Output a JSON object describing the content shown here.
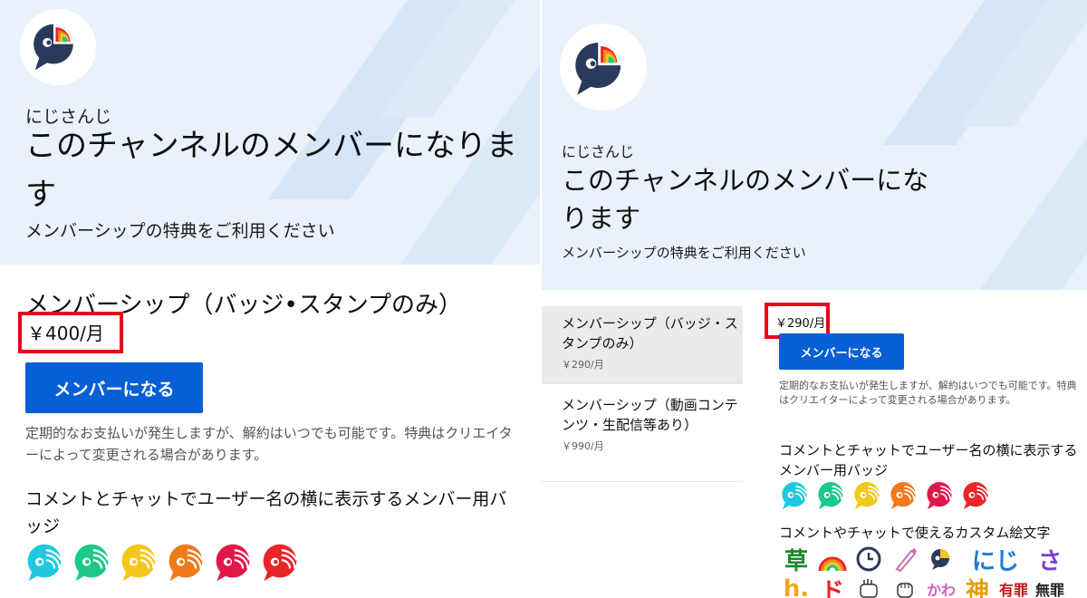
{
  "left": {
    "channel_name": "にじさんじ",
    "title": "このチャンネルのメンバーになります",
    "subtitle": "メンバーシップの特典をご利用ください",
    "tier_name": "メンバーシップ（バッジ•スタンプのみ）",
    "price": "￥400/月",
    "join_button": "メンバーになる",
    "disclaimer": "定期的なお支払いが発生しますが、解約はいつでも可能です。特典はクリエイターによって変更される場合があります。",
    "perk_title": "コメントとチャットでユーザー名の横に表示するメンバー用バッジ"
  },
  "right": {
    "channel_name": "にじさんじ",
    "title": "このチャンネルのメンバーになります",
    "subtitle": "メンバーシップの特典をご利用ください",
    "tiers": [
      {
        "name": "メンバーシップ（バッジ・スタンプのみ）",
        "price": "￥290/月"
      },
      {
        "name": "メンバーシップ（動画コンテンツ・生配信等あり）",
        "price": "￥990/月"
      }
    ],
    "price": "￥290/月",
    "join_button": "メンバーになる",
    "disclaimer": "定期的なお支払いが発生しますが、解約はいつでも可能です。特典はクリエイターによって変更される場合があります。",
    "perk_title": "コメントとチャットでユーザー名の横に表示するメンバー用バッジ",
    "emoji_title": "コメントやチャットで使えるカスタム絵文字",
    "emojis_row1": [
      "草",
      "にじ",
      "さ"
    ],
    "emojis_row2": [
      "h.",
      "ド",
      "かわ",
      "神",
      "有罪",
      "無罪"
    ]
  },
  "colors": {
    "accent": "#065fd4",
    "highlight": "#e8001c",
    "hero_bg": "#e9f1fb",
    "badge_colors": [
      "#1fc8e0",
      "#1cc88a",
      "#f2c81a",
      "#f07a1a",
      "#e0174a",
      "#e8262a"
    ]
  }
}
